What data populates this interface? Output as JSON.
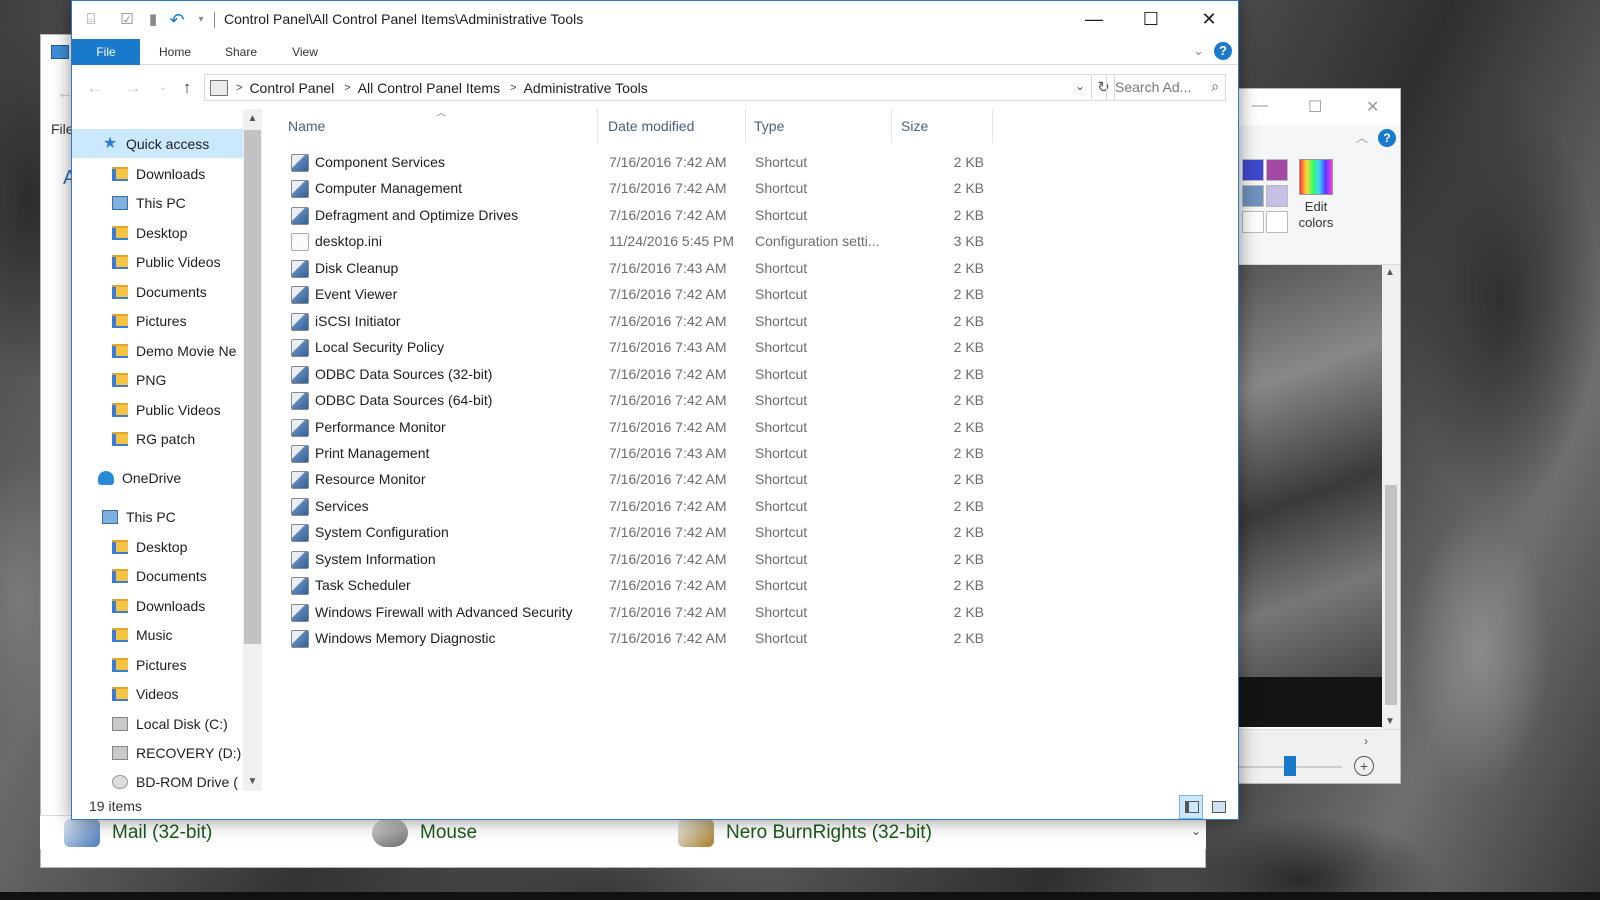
{
  "window": {
    "title": "Control Panel\\All Control Panel Items\\Administrative Tools",
    "buttons": {
      "minimize": "—",
      "maximize": "☐",
      "close": "✕"
    }
  },
  "ribbon": {
    "tabs": [
      "File",
      "Home",
      "Share",
      "View"
    ],
    "help": "?"
  },
  "address": {
    "crumbs": [
      "Control Panel",
      "All Control Panel Items",
      "Administrative Tools"
    ],
    "search_placeholder": "Search Ad..."
  },
  "nav": {
    "items": [
      {
        "label": "Quick access",
        "icon": "star-icon",
        "pinned": false,
        "selected": true
      },
      {
        "label": "Downloads",
        "icon": "folder-icon",
        "pinned": true
      },
      {
        "label": "This PC",
        "icon": "pc-icon",
        "pinned": true
      },
      {
        "label": "Desktop",
        "icon": "folder-icon",
        "pinned": true
      },
      {
        "label": "Public Videos",
        "icon": "folder-icon",
        "pinned": true
      },
      {
        "label": "Documents",
        "icon": "folder-icon",
        "pinned": true
      },
      {
        "label": "Pictures",
        "icon": "folder-icon",
        "pinned": true
      },
      {
        "label": "Demo Movie Ne",
        "icon": "folder-icon",
        "pinned": false
      },
      {
        "label": "PNG",
        "icon": "folder-icon",
        "pinned": false
      },
      {
        "label": "Public Videos",
        "icon": "folder-icon",
        "pinned": false
      },
      {
        "label": "RG patch",
        "icon": "folder-icon",
        "pinned": false
      },
      {
        "label": "OneDrive",
        "icon": "cloud-icon",
        "pinned": false
      },
      {
        "label": "This PC",
        "icon": "pc-icon",
        "pinned": false
      },
      {
        "label": "Desktop",
        "icon": "folder-icon",
        "pinned": false
      },
      {
        "label": "Documents",
        "icon": "folder-icon",
        "pinned": false
      },
      {
        "label": "Downloads",
        "icon": "folder-icon",
        "pinned": false
      },
      {
        "label": "Music",
        "icon": "folder-icon",
        "pinned": false
      },
      {
        "label": "Pictures",
        "icon": "folder-icon",
        "pinned": false
      },
      {
        "label": "Videos",
        "icon": "folder-icon",
        "pinned": false
      },
      {
        "label": "Local Disk (C:)",
        "icon": "disk-icon",
        "pinned": false
      },
      {
        "label": "RECOVERY (D:)",
        "icon": "disk-icon",
        "pinned": false
      },
      {
        "label": "BD-ROM Drive (",
        "icon": "disc-icon",
        "pinned": false
      }
    ]
  },
  "columns": [
    "Name",
    "Date modified",
    "Type",
    "Size"
  ],
  "files": [
    {
      "name": "Component Services",
      "date": "7/16/2016 7:42 AM",
      "type": "Shortcut",
      "size": "2 KB"
    },
    {
      "name": "Computer Management",
      "date": "7/16/2016 7:42 AM",
      "type": "Shortcut",
      "size": "2 KB"
    },
    {
      "name": "Defragment and Optimize Drives",
      "date": "7/16/2016 7:42 AM",
      "type": "Shortcut",
      "size": "2 KB"
    },
    {
      "name": "desktop.ini",
      "date": "11/24/2016 5:45 PM",
      "type": "Configuration setti...",
      "size": "3 KB"
    },
    {
      "name": "Disk Cleanup",
      "date": "7/16/2016 7:43 AM",
      "type": "Shortcut",
      "size": "2 KB"
    },
    {
      "name": "Event Viewer",
      "date": "7/16/2016 7:42 AM",
      "type": "Shortcut",
      "size": "2 KB"
    },
    {
      "name": "iSCSI Initiator",
      "date": "7/16/2016 7:42 AM",
      "type": "Shortcut",
      "size": "2 KB"
    },
    {
      "name": "Local Security Policy",
      "date": "7/16/2016 7:43 AM",
      "type": "Shortcut",
      "size": "2 KB"
    },
    {
      "name": "ODBC Data Sources (32-bit)",
      "date": "7/16/2016 7:42 AM",
      "type": "Shortcut",
      "size": "2 KB"
    },
    {
      "name": "ODBC Data Sources (64-bit)",
      "date": "7/16/2016 7:42 AM",
      "type": "Shortcut",
      "size": "2 KB"
    },
    {
      "name": "Performance Monitor",
      "date": "7/16/2016 7:42 AM",
      "type": "Shortcut",
      "size": "2 KB"
    },
    {
      "name": "Print Management",
      "date": "7/16/2016 7:43 AM",
      "type": "Shortcut",
      "size": "2 KB"
    },
    {
      "name": "Resource Monitor",
      "date": "7/16/2016 7:42 AM",
      "type": "Shortcut",
      "size": "2 KB"
    },
    {
      "name": "Services",
      "date": "7/16/2016 7:42 AM",
      "type": "Shortcut",
      "size": "2 KB"
    },
    {
      "name": "System Configuration",
      "date": "7/16/2016 7:42 AM",
      "type": "Shortcut",
      "size": "2 KB"
    },
    {
      "name": "System Information",
      "date": "7/16/2016 7:42 AM",
      "type": "Shortcut",
      "size": "2 KB"
    },
    {
      "name": "Task Scheduler",
      "date": "7/16/2016 7:42 AM",
      "type": "Shortcut",
      "size": "2 KB"
    },
    {
      "name": "Windows Firewall with Advanced Security",
      "date": "7/16/2016 7:42 AM",
      "type": "Shortcut",
      "size": "2 KB"
    },
    {
      "name": "Windows Memory Diagnostic",
      "date": "7/16/2016 7:42 AM",
      "type": "Shortcut",
      "size": "2 KB"
    }
  ],
  "status": {
    "item_count": "19 items"
  },
  "background": {
    "left_window": {
      "file_tab": "File",
      "heading_letter": "A"
    },
    "control_panel_items": [
      "Mail (32-bit)",
      "Mouse",
      "Nero BurnRights (32-bit)"
    ],
    "paint": {
      "edit_colors": "Edit colors"
    }
  },
  "colors": {
    "accent": "#1979ca",
    "selection": "#cce8ff",
    "column_header_text": "#4c607a",
    "secondary_text": "#6d6d6d"
  }
}
